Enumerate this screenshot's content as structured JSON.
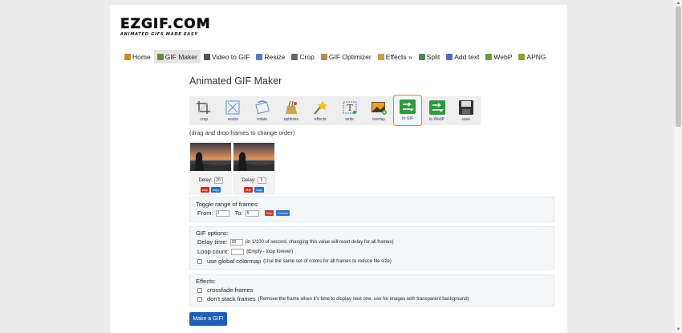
{
  "logo": {
    "main": "EZGIF.COM",
    "tagline": "ANIMATED GIFS MADE EASY"
  },
  "nav": [
    {
      "label": "Home",
      "icon": "home-icon",
      "color": "#c98a2a"
    },
    {
      "label": "GIF Maker",
      "icon": "gif-maker-icon",
      "color": "#6a8a3a",
      "active": true
    },
    {
      "label": "Video to GIF",
      "icon": "video-icon",
      "color": "#555555"
    },
    {
      "label": "Resize",
      "icon": "resize-icon",
      "color": "#5a7abf"
    },
    {
      "label": "Crop",
      "icon": "crop-icon",
      "color": "#666666"
    },
    {
      "label": "GIF Optimizer",
      "icon": "optimizer-icon",
      "color": "#b08a4a"
    },
    {
      "label": "Effects »",
      "icon": "effects-icon",
      "color": "#c9a040"
    },
    {
      "label": "Split",
      "icon": "split-icon",
      "color": "#4a8a4a"
    },
    {
      "label": "Add text",
      "icon": "text-icon",
      "color": "#5a6abf"
    },
    {
      "label": "WebP",
      "icon": "webp-icon",
      "color": "#6a9a3a"
    },
    {
      "label": "APNG",
      "icon": "apng-icon",
      "color": "#8aa03a"
    }
  ],
  "title": "Animated GIF Maker",
  "tools": [
    {
      "label": "crop",
      "icon": "crop-tool-icon"
    },
    {
      "label": "resize",
      "icon": "resize-tool-icon"
    },
    {
      "label": "rotate",
      "icon": "rotate-tool-icon"
    },
    {
      "label": "optimize",
      "icon": "optimize-tool-icon"
    },
    {
      "label": "effects",
      "icon": "effects-tool-icon"
    },
    {
      "label": "write",
      "icon": "write-tool-icon"
    },
    {
      "label": "overlay",
      "icon": "overlay-tool-icon"
    },
    {
      "label": "to GIF",
      "icon": "to-gif-tool-icon",
      "selected": true
    },
    {
      "label": "to WebP",
      "icon": "to-webp-tool-icon"
    },
    {
      "label": "save",
      "icon": "save-tool-icon"
    }
  ],
  "hint": "(drag and drop frames to change order)",
  "frames": [
    {
      "delay_label": "Delay:",
      "delay": "20",
      "skip": "skip",
      "copy": "copy"
    },
    {
      "delay_label": "Delay:",
      "delay": "5",
      "skip": "skip",
      "copy": "copy"
    }
  ],
  "toggle": {
    "title": "Toggle range of frames:",
    "from_label": "From:",
    "from_value": "1",
    "to_label": "To:",
    "to_value": "5",
    "skip": "Skip",
    "enable": "Enable"
  },
  "gif_options": {
    "title": "GIF options:",
    "delay_label": "Delay time:",
    "delay_value": "20",
    "delay_note": "(in 1/100 of second, changing this value will reset delay for all frames)",
    "loop_label": "Loop count:",
    "loop_value": "",
    "loop_note": "(Empty - loop forever)",
    "colormap_label": "use global colormap",
    "colormap_note": "(Use the same set of colors for all frames to reduce file size)"
  },
  "effects": {
    "title": "Effects:",
    "crossfade_label": "crossfade frames",
    "nostack_label": "don't stack frames",
    "nostack_note": "(Remove the frame when it's time to display next one, use for images with transparent background)"
  },
  "make_button": "Make a GIF!"
}
